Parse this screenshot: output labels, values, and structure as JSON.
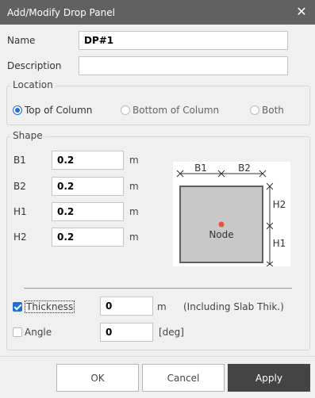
{
  "dialog": {
    "title": "Add/Modify Drop Panel",
    "close_glyph": "✕"
  },
  "fields": {
    "name_label": "Name",
    "name_value": "DP#1",
    "description_label": "Description",
    "description_value": ""
  },
  "location": {
    "group_label": "Location",
    "options": [
      {
        "label": "Top of Column",
        "selected": true
      },
      {
        "label": "Bottom of Column",
        "selected": false
      },
      {
        "label": "Both",
        "selected": false
      }
    ]
  },
  "shape": {
    "group_label": "Shape",
    "rows": [
      {
        "label": "B1",
        "value": "0.2",
        "unit": "m"
      },
      {
        "label": "B2",
        "value": "0.2",
        "unit": "m"
      },
      {
        "label": "H1",
        "value": "0.2",
        "unit": "m"
      },
      {
        "label": "H2",
        "value": "0.2",
        "unit": "m"
      }
    ],
    "diagram": {
      "b1_label": "B1",
      "b2_label": "B2",
      "h1_label": "H1",
      "h2_label": "H2",
      "node_label": "Node",
      "node_color": "#e8503a",
      "panel_fill": "#c8c8c8",
      "panel_stroke": "#606060"
    }
  },
  "thickness": {
    "label": "Thickness",
    "checked": true,
    "value": "0",
    "unit": "m",
    "note": "(Including Slab Thik.)"
  },
  "angle": {
    "label": "Angle",
    "checked": false,
    "value": "0",
    "unit": "[deg]"
  },
  "buttons": {
    "ok": "OK",
    "cancel": "Cancel",
    "apply": "Apply"
  },
  "colors": {
    "titlebar": "#616161",
    "accent": "#1e6fd9",
    "primary_button": "#444444"
  }
}
